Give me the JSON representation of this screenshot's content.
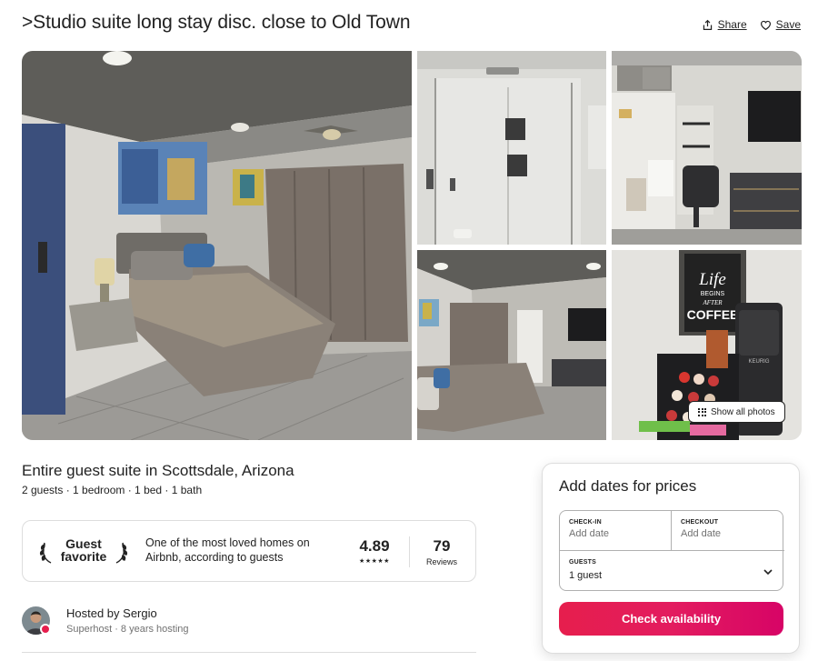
{
  "listing": {
    "title": ">Studio suite long stay disc. close to Old Town",
    "share_label": "Share",
    "save_label": "Save",
    "show_all_photos_label": "Show all photos",
    "type": "Entire guest suite in Scottsdale, Arizona",
    "facts": "2 guests · 1 bedroom · 1 bed · 1 bath"
  },
  "photo_art": {
    "life_line1": "Life",
    "life_line2": "BEGINS",
    "life_line3": "AFTER",
    "life_line4": "COFFEE",
    "brand": "KEURIG"
  },
  "guest_favorite": {
    "badge_line1": "Guest",
    "badge_line2": "favorite",
    "description": "One of the most loved homes on Airbnb, according to guests",
    "rating": "4.89",
    "stars": "★★★★★",
    "reviews_count": "79",
    "reviews_label": "Reviews"
  },
  "host": {
    "name": "Hosted by Sergio",
    "subtitle": "Superhost · 8 years hosting"
  },
  "booking": {
    "title": "Add dates for prices",
    "checkin_label": "CHECK-IN",
    "checkin_value": "Add date",
    "checkout_label": "CHECKOUT",
    "checkout_value": "Add date",
    "guests_label": "GUESTS",
    "guests_value": "1 guest",
    "button_label": "Check availability"
  },
  "colors": {
    "brand": "#e61e4d",
    "text": "#222222",
    "muted": "#717171",
    "border": "#dddddd"
  }
}
